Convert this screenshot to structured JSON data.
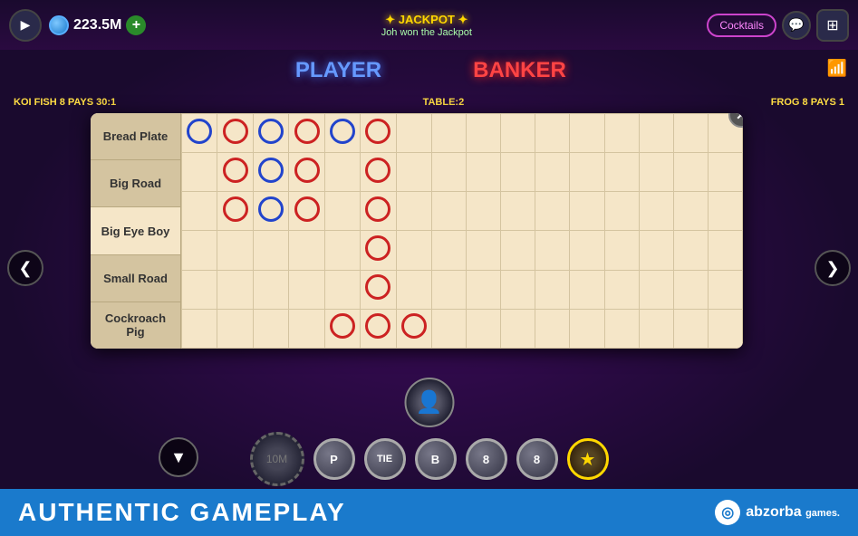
{
  "topbar": {
    "coin_amount": "223.5M",
    "add_label": "+",
    "jackpot_title": "✦ JACKPOT ✦",
    "jackpot_subtitle": "Joh won the Jackpot",
    "cocktails_label": "Cocktails",
    "chat_icon": "💬",
    "grid_icon": "⊞"
  },
  "game": {
    "player_label": "PLAYER",
    "banker_label": "BANKER",
    "koi_fish": "KOI FISH 8 PAYS 30:1",
    "table_number": "TABLE:2",
    "frog_label": "FROG 8 PAYS 1",
    "wifi_icon": "📶"
  },
  "roadmap": {
    "close_label": "✕",
    "sidebar_items": [
      {
        "id": "bread-plate",
        "label": "Bread Plate"
      },
      {
        "id": "big-road",
        "label": "Big Road"
      },
      {
        "id": "big-eye-boy",
        "label": "Big Eye Boy"
      },
      {
        "id": "small-road",
        "label": "Small Road"
      },
      {
        "id": "cockroach-pig",
        "label": "Cockroach Pig"
      }
    ],
    "grid_rows": 6,
    "grid_cols": 16,
    "circles": [
      {
        "row": 0,
        "col": 0,
        "type": "blue"
      },
      {
        "row": 0,
        "col": 1,
        "type": "red"
      },
      {
        "row": 0,
        "col": 2,
        "type": "blue"
      },
      {
        "row": 0,
        "col": 3,
        "type": "red"
      },
      {
        "row": 0,
        "col": 4,
        "type": "blue"
      },
      {
        "row": 0,
        "col": 5,
        "type": "red"
      },
      {
        "row": 1,
        "col": 1,
        "type": "red"
      },
      {
        "row": 1,
        "col": 2,
        "type": "blue"
      },
      {
        "row": 1,
        "col": 3,
        "type": "red"
      },
      {
        "row": 1,
        "col": 5,
        "type": "red"
      },
      {
        "row": 2,
        "col": 1,
        "type": "red"
      },
      {
        "row": 2,
        "col": 2,
        "type": "blue"
      },
      {
        "row": 2,
        "col": 3,
        "type": "red"
      },
      {
        "row": 2,
        "col": 5,
        "type": "red"
      },
      {
        "row": 3,
        "col": 5,
        "type": "red"
      },
      {
        "row": 4,
        "col": 5,
        "type": "red"
      },
      {
        "row": 5,
        "col": 4,
        "type": "red"
      },
      {
        "row": 5,
        "col": 5,
        "type": "red"
      },
      {
        "row": 5,
        "col": 6,
        "type": "red"
      }
    ]
  },
  "bottom": {
    "down_arrow": "▼",
    "left_arrow": "❮",
    "right_arrow": "❯",
    "player_chip": "P",
    "tie_chip": "TIE",
    "banker_chip": "B",
    "chip_8_label": "8",
    "chip_8b_label": "8",
    "star_label": "★",
    "ten_million": "10M"
  },
  "footer": {
    "text": "AUTHENTIC GAMEPLAY",
    "logo_text": "abzorba",
    "logo_sub": "games.",
    "logo_icon": "◎"
  }
}
